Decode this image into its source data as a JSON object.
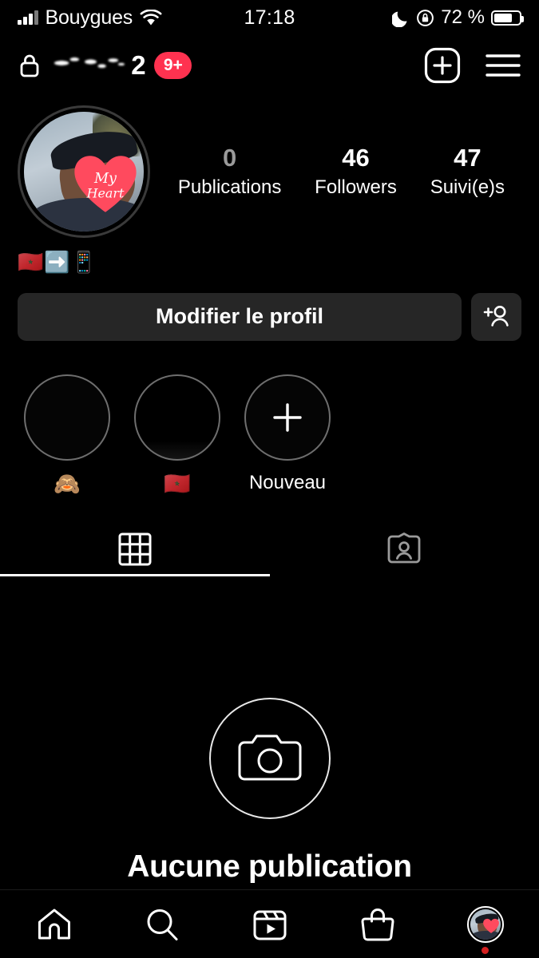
{
  "status_bar": {
    "carrier": "Bouygues",
    "time": "17:18",
    "battery_text": "72 %",
    "battery_level": 72,
    "icons": [
      "signal-bars-icon",
      "wifi-icon",
      "moon-dnd-icon",
      "rotation-lock-icon",
      "battery-icon"
    ]
  },
  "header": {
    "lock_icon": "lock-icon",
    "username": "•••••••••",
    "username_suffix": "2",
    "notification_badge": "9+",
    "add_icon": "plus-square-icon",
    "menu_icon": "hamburger-menu-icon"
  },
  "profile": {
    "avatar_name": "profile-photo",
    "stats": [
      {
        "value": "0",
        "label": "Publications",
        "dim": true
      },
      {
        "value": "46",
        "label": "Followers",
        "dim": false
      },
      {
        "value": "47",
        "label": "Suivi(e)s",
        "dim": false
      }
    ],
    "bio": "🇲🇦➡️📱"
  },
  "actions": {
    "edit_profile_label": "Modifier le profil",
    "add_user_icon": "add-person-icon"
  },
  "highlights": [
    {
      "label": "🙈",
      "type": "emoji",
      "name": "story-highlight-monkey"
    },
    {
      "label": "🇲🇦",
      "type": "emoji",
      "name": "story-highlight-morocco"
    },
    {
      "label": "Nouveau",
      "type": "new",
      "name": "story-highlight-new"
    }
  ],
  "tabs": [
    {
      "label": "",
      "icon": "grid-icon",
      "active": true,
      "name": "tab-posts-grid"
    },
    {
      "label": "",
      "icon": "tagged-user-icon",
      "active": false,
      "name": "tab-tagged"
    }
  ],
  "empty_state": {
    "icon": "camera-icon",
    "title": "Aucune publication"
  },
  "bottom_nav": [
    {
      "icon": "home-icon",
      "name": "nav-home",
      "active": false
    },
    {
      "icon": "search-icon",
      "name": "nav-search",
      "active": false
    },
    {
      "icon": "reels-icon",
      "name": "nav-reels",
      "active": false
    },
    {
      "icon": "shop-bag-icon",
      "name": "nav-shop",
      "active": false
    },
    {
      "icon": "avatar-icon",
      "name": "nav-profile",
      "active": true
    }
  ],
  "colors": {
    "background": "#000000",
    "surface": "#262626",
    "badge_red": "#FF3250",
    "notification_dot": "#D42020",
    "text_primary": "#FFFFFF",
    "text_secondary": "#9A9A9A",
    "heart_sticker": "#FF4A5E"
  }
}
